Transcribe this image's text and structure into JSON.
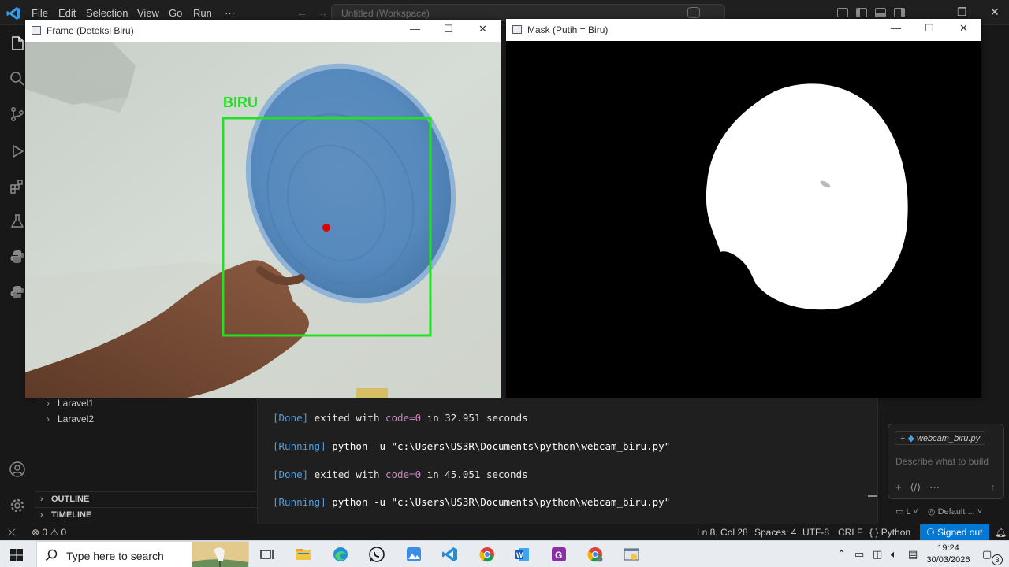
{
  "titlebar": {
    "menus": [
      "File",
      "Edit",
      "Selection",
      "View",
      "Go",
      "Run",
      "···"
    ],
    "command_center": "Untitled (Workspace)"
  },
  "frame_window": {
    "title": "Frame (Deteksi Biru)",
    "detection_label": "BIRU"
  },
  "mask_window": {
    "title": "Mask (Putih = Biru)"
  },
  "sidebar": {
    "tree_items": [
      "Laravel1",
      "Laravel2"
    ],
    "sections": [
      "OUTLINE",
      "TIMELINE"
    ]
  },
  "output": {
    "lines": [
      {
        "tag": "[Done]",
        "text1": " exited with ",
        "kw": "code=0",
        "text2": " in 32.951 seconds"
      },
      {
        "tag": "[Running]",
        "text1": " python -u \"c:\\Users\\US3R\\Documents\\python\\webcam_biru.py\""
      },
      {
        "tag": "[Done]",
        "text1": " exited with ",
        "kw": "code=0",
        "text2": " in 45.051 seconds"
      },
      {
        "tag": "[Running]",
        "text1": " python -u \"c:\\Users\\US3R\\Documents\\python\\webcam_biru.py\""
      }
    ]
  },
  "chat": {
    "file_chip": "webcam_biru.py",
    "placeholder": "Describe what to build",
    "bottom_left": "L",
    "bottom_right": "Default ..."
  },
  "statusbar": {
    "errors": "0",
    "warnings": "0",
    "position": "Ln 8, Col 28",
    "spaces": "Spaces: 4",
    "encoding": "UTF-8",
    "eol": "CRLF",
    "language": "Python",
    "account": "Signed out"
  },
  "taskbar": {
    "search": "Type here to search",
    "time": "19:24",
    "date": "30/03/2026",
    "notifications": "3"
  },
  "colors": {
    "accent": "#0078d4",
    "detection_box": "#22e022",
    "centroid": "#e00000"
  }
}
